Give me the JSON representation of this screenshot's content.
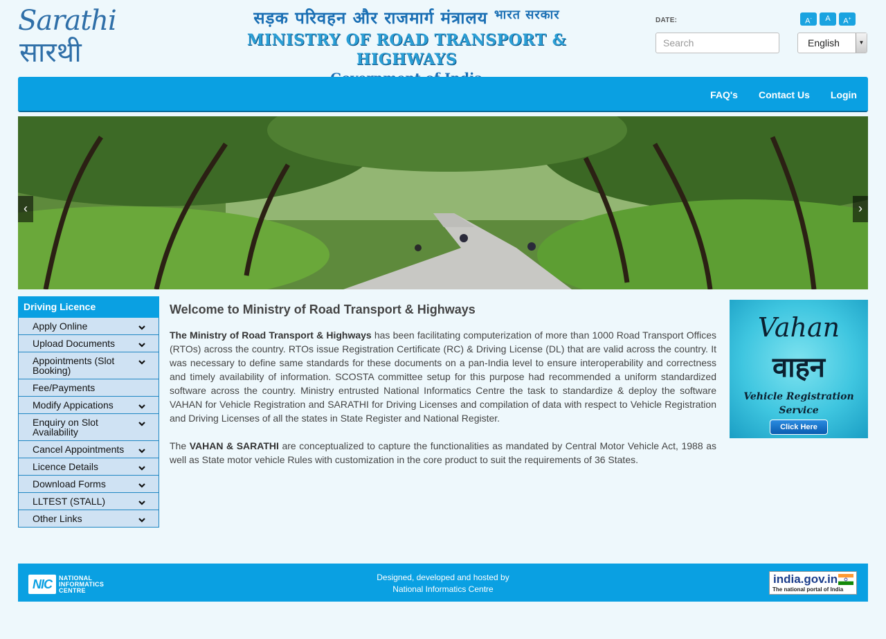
{
  "logo": {
    "latin": "Sarathi",
    "devanagari": "सारथी"
  },
  "ministry": {
    "hindi_main": "सड़क परिवहन और राजमार्ग मंत्रालय",
    "hindi_small": "भारत सरकार",
    "english": "MINISTRY OF ROAD TRANSPORT & HIGHWAYS",
    "government": "Government of India"
  },
  "header": {
    "date_label": "DATE:",
    "search_placeholder": "Search",
    "language": "English",
    "font_sizes": [
      "A-",
      "A",
      "A+"
    ]
  },
  "nav": {
    "items": [
      "FAQ's",
      "Contact Us",
      "Login"
    ]
  },
  "banner": {
    "prev": "‹",
    "next": "›"
  },
  "sidebar": {
    "title": "Driving Licence",
    "items": [
      {
        "label": "Apply Online",
        "expandable": true
      },
      {
        "label": "Upload Documents",
        "expandable": true
      },
      {
        "label": "Appointments (Slot Booking)",
        "expandable": true
      },
      {
        "label": "Fee/Payments",
        "expandable": false
      },
      {
        "label": "Modify Appications",
        "expandable": true
      },
      {
        "label": "Enquiry on Slot Availability",
        "expandable": true
      },
      {
        "label": "Cancel Appointments",
        "expandable": true
      },
      {
        "label": "Licence Details",
        "expandable": true
      },
      {
        "label": "Download Forms",
        "expandable": true
      },
      {
        "label": "LLTEST (STALL)",
        "expandable": true
      },
      {
        "label": "Other Links",
        "expandable": true
      }
    ]
  },
  "main": {
    "title": "Welcome to Ministry of Road Transport & Highways",
    "p1_bold": "The Ministry of Road Transport & Highways",
    "p1_rest": " has been facilitating computerization of more than 1000 Road Transport Offices (RTOs) across the country. RTOs issue Registration Certificate (RC) & Driving License (DL) that are valid across the country. It was necessary to define same standards for these documents on a pan-India level to ensure interoperability and correctness and timely availability of information. SCOSTA committee setup for this purpose had recommended a uniform standardized software across the country. Ministry entrusted National Informatics Centre the task to standardize & deploy the software VAHAN for Vehicle Registration and SARATHI for Driving Licenses and compilation of data with respect to Vehicle Registration and Driving Licenses of all the states in State Register and National Register.",
    "p2_pre": "The ",
    "p2_bold": "VAHAN & SARATHI",
    "p2_rest": " are conceptualized to capture the functionalities as mandated by Central Motor Vehicle Act, 1988 as well as State motor vehicle Rules with customization in the core product to suit the requirements of 36 States."
  },
  "vahan_ad": {
    "title_latin": "Vahan",
    "title_devanagari": "वाहन",
    "line1": "Vehicle Registration",
    "line2": "Service",
    "button": "Click Here"
  },
  "footer": {
    "nic_mark": "NIC",
    "nic_line1": "NATIONAL",
    "nic_line2": "INFORMATICS",
    "nic_line3": "CENTRE",
    "line1": "Designed, developed and hosted by",
    "line2": "National Informatics Centre",
    "india_gov": "india.gov.in",
    "india_gov_tag": "The national portal of India"
  },
  "colors": {
    "accent": "#0aa0e2",
    "background": "#eef8fc",
    "sidebar_item": "#cfe2f3"
  }
}
